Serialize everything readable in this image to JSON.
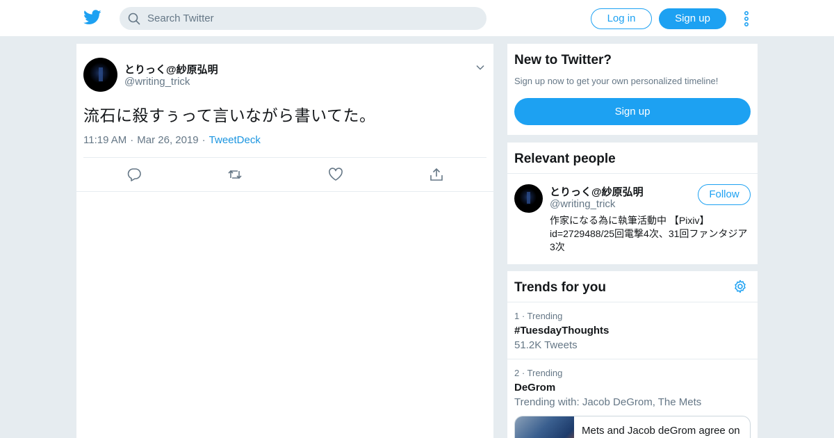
{
  "colors": {
    "accent": "#1da1f2",
    "link": "#1b95e0",
    "muted": "#657786",
    "background": "#e6ecf0"
  },
  "header": {
    "search_placeholder": "Search Twitter",
    "login_label": "Log in",
    "signup_label": "Sign up"
  },
  "tweet": {
    "display_name": "とりっく@紗原弘明",
    "handle": "@writing_trick",
    "text": "流石に殺すぅって言いながら書いてた。",
    "time": "11:19 AM",
    "dot1": "·",
    "date": "Mar 26, 2019",
    "dot2": "·",
    "source": "TweetDeck",
    "actions": [
      "reply-icon",
      "retweet-icon",
      "like-icon",
      "share-icon"
    ]
  },
  "new_to_twitter": {
    "title": "New to Twitter?",
    "subtitle": "Sign up now to get your own personalized timeline!",
    "button": "Sign up"
  },
  "relevant_people": {
    "title": "Relevant people",
    "person": {
      "name": "とりっく@紗原弘明",
      "handle": "@writing_trick",
      "follow": "Follow",
      "bio": "作家になる為に執筆活動中 【Pixiv】 id=2729488/25回電撃4次、31回ファンタジア3次"
    }
  },
  "trends": {
    "title": "Trends for you",
    "items": [
      {
        "rank": "1 · Trending",
        "name": "#TuesdayThoughts",
        "info": "51.2K Tweets"
      },
      {
        "rank": "2 · Trending",
        "name": "DeGrom",
        "info": "Trending with: Jacob DeGrom, The Mets"
      }
    ],
    "news_headline": "Mets and Jacob deGrom agree on"
  }
}
